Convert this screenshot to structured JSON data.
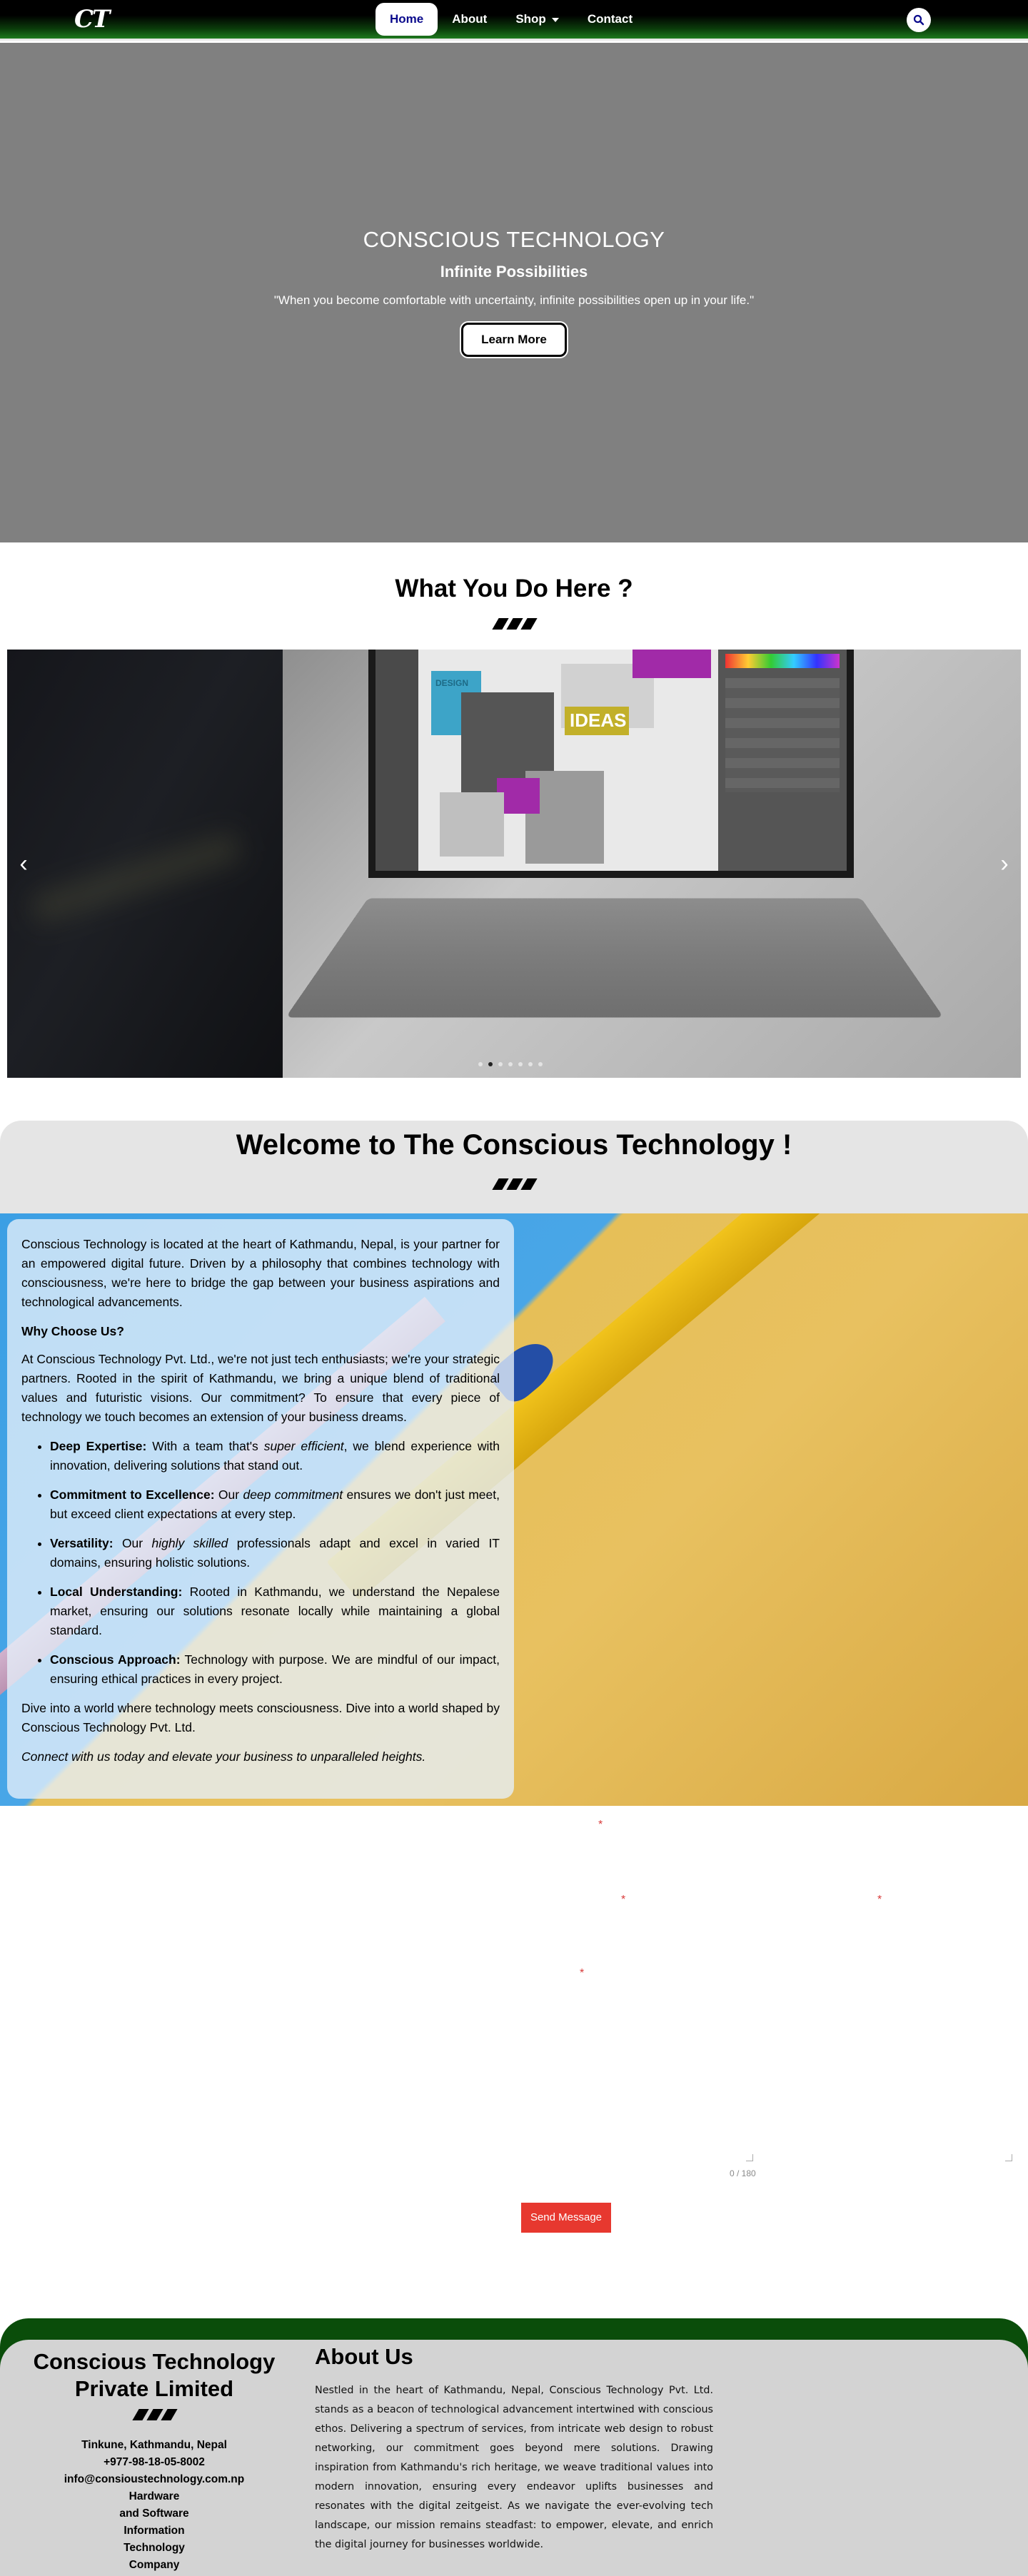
{
  "nav": {
    "logo": "CT",
    "items": [
      {
        "label": "Home",
        "active": true
      },
      {
        "label": "About",
        "active": false
      },
      {
        "label": "Shop",
        "active": false,
        "dropdown": true
      },
      {
        "label": "Contact",
        "active": false
      }
    ],
    "search_icon": "search-icon"
  },
  "hero": {
    "title": "CONSCIOUS TECHNOLOGY",
    "subtitle": "Infinite Possibilities",
    "quote": "\"When you become comfortable with uncertainty, infinite possibilities open up in your life.\"",
    "button": "Learn More"
  },
  "what_you_do": {
    "title": "What You Do Here ?",
    "slider": {
      "screen_label": "IDEAS",
      "design_label": "DESIGN",
      "prev_icon": "chevron-left-icon",
      "next_icon": "chevron-right-icon",
      "dot_count": 7,
      "active_dot": 1
    }
  },
  "welcome": {
    "title": "Welcome to The Conscious Technology !",
    "intro": "Conscious Technology is located at the heart of Kathmandu, Nepal, is your partner for an empowered digital future. Driven by a philosophy that combines technology with consciousness, we're here to bridge the gap between your business aspirations and technological advancements.",
    "why_heading": "Why Choose Us?",
    "why_text": "At Conscious Technology Pvt. Ltd., we're not just tech enthusiasts; we're your strategic partners. Rooted in the spirit of Kathmandu, we bring a unique blend of traditional values and futuristic visions. Our commitment? To ensure that every piece of technology we touch becomes an extension of your business dreams.",
    "points": [
      {
        "label": "Deep Expertise:",
        "pre": " With a team that's ",
        "em": "super efficient",
        "post": ", we blend experience with innovation, delivering solutions that stand out."
      },
      {
        "label": "Commitment to Excellence:",
        "pre": " Our ",
        "em": "deep commitment",
        "post": " ensures we don't just meet, but exceed client expectations at every step."
      },
      {
        "label": "Versatility:",
        "pre": " Our ",
        "em": "highly skilled",
        "post": " professionals adapt and excel in varied IT domains, ensuring holistic solutions."
      },
      {
        "label": "Local Understanding:",
        "pre": " Rooted in Kathmandu, we understand the Nepalese market, ensuring our solutions resonate locally while maintaining a global standard.",
        "em": "",
        "post": ""
      },
      {
        "label": "Conscious Approach:",
        "pre": " Technology with purpose. We are mindful of our impact, ensuring ethical practices in every project.",
        "em": "",
        "post": ""
      }
    ],
    "outro": "Dive into a world where technology meets consciousness. Dive into a world shaped by Conscious Technology Pvt. Ltd.",
    "closing": "Connect with us today and elevate your business to unparalleled heights."
  },
  "form": {
    "required_mark": "*",
    "counter": "0 / 180",
    "send_button": "Send Message"
  },
  "footer": {
    "company": "Conscious Technology Private Limited",
    "address": "Tinkune, Kathmandu, Nepal",
    "phone": "+977-98-18-05-8002",
    "email": "info@consioustechnology.com.np",
    "category": "Hardware and Software Information Technology Company",
    "about_title": "About Us",
    "about_text": "Nestled in the heart of Kathmandu, Nepal, Conscious Technology Pvt. Ltd. stands as a beacon of technological advancement intertwined with conscious ethos. Delivering a spectrum of services, from intricate web design to robust networking, our commitment goes beyond mere solutions. Drawing inspiration from Kathmandu's rich heritage, we weave traditional values into modern innovation, ensuring every endeavor uplifts businesses and resonates with the digital zeitgeist. As we navigate the ever-evolving tech landscape, our mission remains steadfast: to empower, elevate, and enrich the digital journey for businesses worldwide."
  },
  "colors": {
    "nav_green": "#1e7a1e",
    "active_text": "#0a0a8c",
    "hero_bg": "#808080",
    "send_button": "#e7382f",
    "footer_bg": "#d3d3d3",
    "footer_green": "#0a4d0a"
  }
}
